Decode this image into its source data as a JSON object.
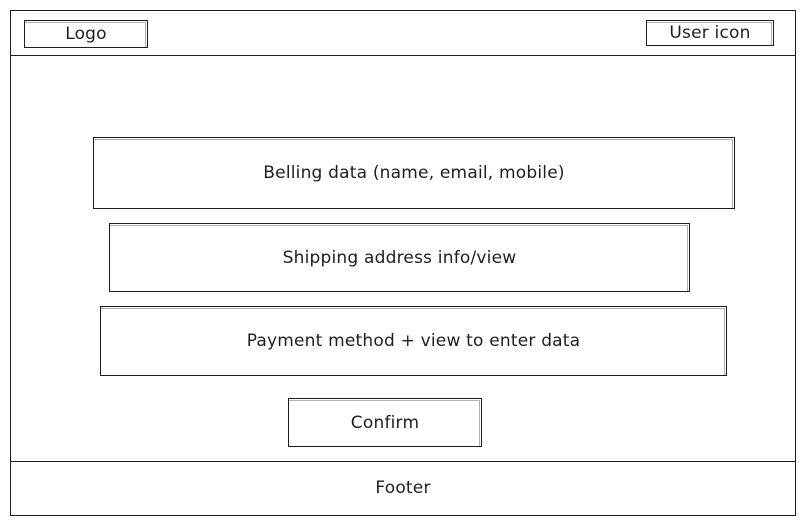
{
  "header": {
    "logo_label": "Logo",
    "user_icon_label": "User icon"
  },
  "main": {
    "billing_label": "Belling data (name, email, mobile)",
    "shipping_label": "Shipping address info/view",
    "payment_label": "Payment method + view to enter data",
    "confirm_label": "Confirm"
  },
  "footer": {
    "label": "Footer"
  }
}
